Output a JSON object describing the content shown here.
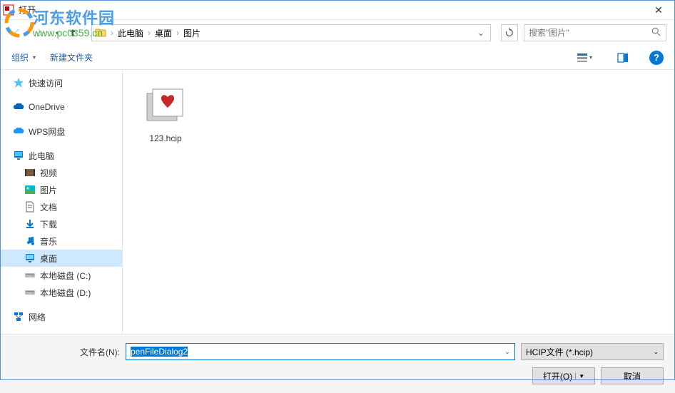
{
  "window": {
    "title": "打开"
  },
  "watermark": {
    "main": "河东软件园",
    "sub": "www.pc0359.cn"
  },
  "nav": {
    "breadcrumb": [
      "此电脑",
      "桌面",
      "图片"
    ],
    "search_placeholder": "搜索\"图片\""
  },
  "toolbar": {
    "organize": "组织",
    "new_folder": "新建文件夹"
  },
  "sidebar": {
    "quick_access": "快速访问",
    "onedrive": "OneDrive",
    "wps": "WPS网盘",
    "this_pc": "此电脑",
    "video": "视频",
    "pictures": "图片",
    "documents": "文档",
    "downloads": "下载",
    "music": "音乐",
    "desktop": "桌面",
    "disk_c": "本地磁盘 (C:)",
    "disk_d": "本地磁盘 (D:)",
    "network": "网络"
  },
  "files": [
    {
      "name": "123.hcip"
    }
  ],
  "bottom": {
    "filename_label": "文件名(N):",
    "filename_value": "penFileDialog2",
    "filetype": "HCIP文件 (*.hcip)",
    "open": "打开(O)",
    "cancel": "取消"
  }
}
